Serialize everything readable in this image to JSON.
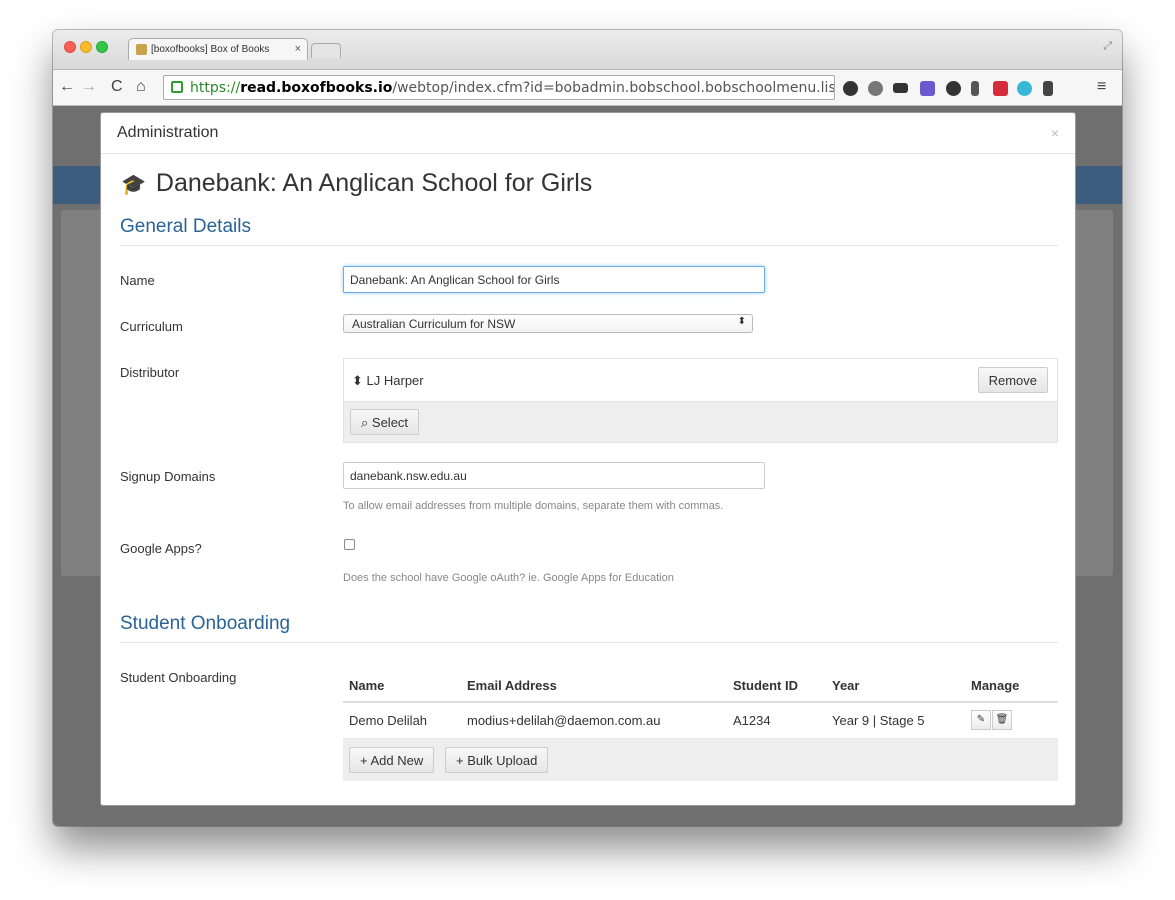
{
  "browser": {
    "tab_title": "[boxofbooks] Box of Books",
    "tab_close": "×",
    "url_scheme": "https://",
    "url_host": "read.boxofbooks.io",
    "url_path": "/webtop/index.cfm?id=bobadmin.bobschool.bobschoolmenu.listsc…"
  },
  "modal": {
    "header_title": "Administration",
    "close": "×",
    "school_name": "Danebank: An Anglican School for Girls",
    "general_details": {
      "heading": "General Details",
      "name_label": "Name",
      "name_value": "Danebank: An Anglican School for Girls",
      "curriculum_label": "Curriculum",
      "curriculum_value": "Australian Curriculum for NSW",
      "distributor_label": "Distributor",
      "distributor_value": "LJ Harper",
      "remove_label": "Remove",
      "select_label": "Select",
      "signup_label": "Signup Domains",
      "signup_value": "danebank.nsw.edu.au",
      "signup_help": "To allow email addresses from multiple domains, separate them with commas.",
      "google_label": "Google Apps?",
      "google_checked": false,
      "google_help": "Does the school have Google oAuth? ie. Google Apps for Education"
    },
    "student_onboarding": {
      "heading": "Student Onboarding",
      "label": "Student Onboarding",
      "columns": [
        "Name",
        "Email Address",
        "Student ID",
        "Year",
        "Manage"
      ],
      "rows": [
        {
          "name": "Demo Delilah",
          "email": "modius+delilah@daemon.com.au",
          "student_id": "A1234",
          "year": "Year 9 | Stage 5"
        }
      ],
      "add_new": "Add New",
      "bulk_upload": "Bulk Upload"
    }
  }
}
